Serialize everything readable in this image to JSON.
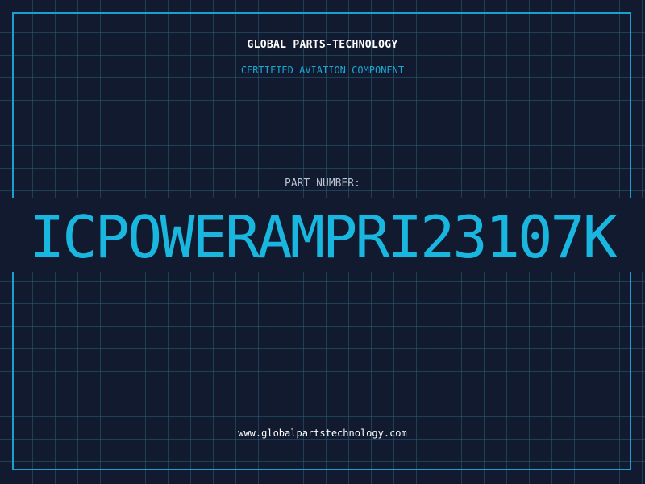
{
  "header": {
    "company": "GLOBAL PARTS-TECHNOLOGY",
    "subtitle": "CERTIFIED AVIATION COMPONENT"
  },
  "part": {
    "label": "PART NUMBER:",
    "number": "ICPOWERAMPRI23107K"
  },
  "footer": {
    "url": "www.globalpartstechnology.com"
  },
  "colors": {
    "background": "#111a2e",
    "grid": "#285f78",
    "accent": "#19b6e0",
    "frame": "#1a9fd0",
    "label": "#b8c4d4",
    "text": "#ffffff"
  }
}
